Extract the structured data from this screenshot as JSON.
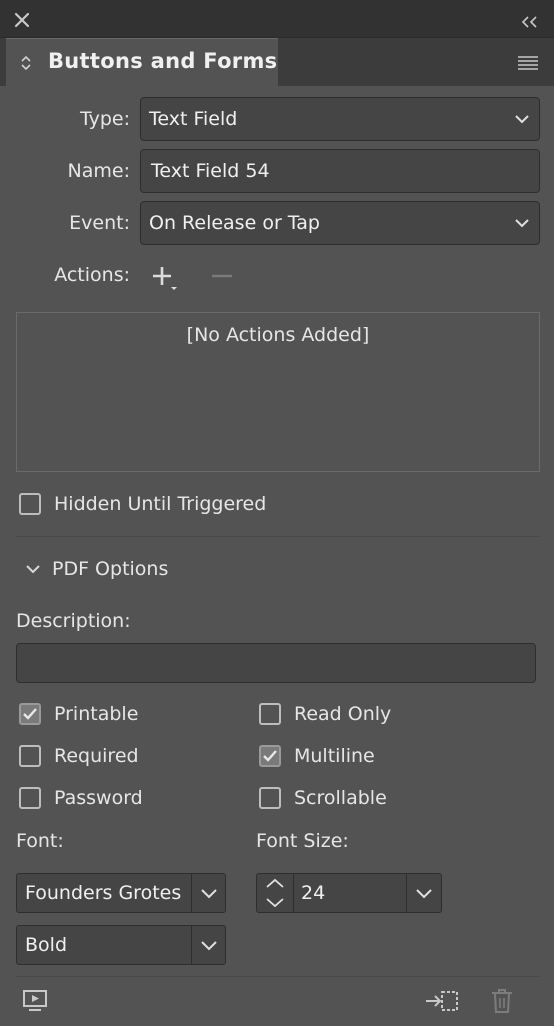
{
  "panel": {
    "title": "Buttons and Forms"
  },
  "form": {
    "type_label": "Type:",
    "type_value": "Text Field",
    "name_label": "Name:",
    "name_value": "Text Field 54",
    "event_label": "Event:",
    "event_value": "On Release or Tap",
    "actions_label": "Actions:",
    "actions_empty": "[No Actions Added]",
    "hidden_label": "Hidden Until Triggered",
    "hidden_checked": false
  },
  "pdf_options": {
    "section_label": "PDF Options",
    "description_label": "Description:",
    "description_value": "",
    "checkboxes": [
      {
        "label": "Printable",
        "checked": true
      },
      {
        "label": "Read Only",
        "checked": false
      },
      {
        "label": "Required",
        "checked": false
      },
      {
        "label": "Multiline",
        "checked": true
      },
      {
        "label": "Password",
        "checked": false
      },
      {
        "label": "Scrollable",
        "checked": false
      }
    ],
    "font_label": "Font:",
    "font_family": "Founders Grotes",
    "font_style": "Bold",
    "font_size_label": "Font Size:",
    "font_size": "24"
  },
  "icons": {
    "close": "close-icon",
    "collapse": "collapse-icon",
    "menu": "hamburger-menu-icon",
    "preview": "preview-icon",
    "convert": "convert-to-object-icon",
    "delete": "trash-icon"
  }
}
